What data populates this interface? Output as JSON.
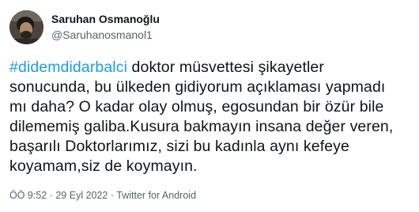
{
  "tweet": {
    "author": {
      "name": "Saruhan Osmanoğlu",
      "handle": "@Saruhanosmanol1"
    },
    "hashtag": "#didemdidarbalci",
    "text_lines": [
      " doktor müsvettesi şikayetler",
      "sonucunda, bu ülkeden gidiyorum açıklaması yapmadı",
      "mı daha? O kadar olay olmuş, egosundan bir özür bile",
      "dilememiş galiba.Kusura bakmayın insana değer veren,",
      "başarılı Doktorlarımız, sizi bu kadınla aynı kefeye",
      "koyamam,siz de koymayın."
    ],
    "meta": {
      "time": "ÖÖ 9:52",
      "separator1": " · ",
      "date": "29 Eyl 2022",
      "separator2": " · ",
      "source": "Twitter for Android"
    },
    "colors": {
      "hashtag": "#1d9bf0",
      "text": "#0f1419",
      "secondary": "#536471"
    }
  }
}
